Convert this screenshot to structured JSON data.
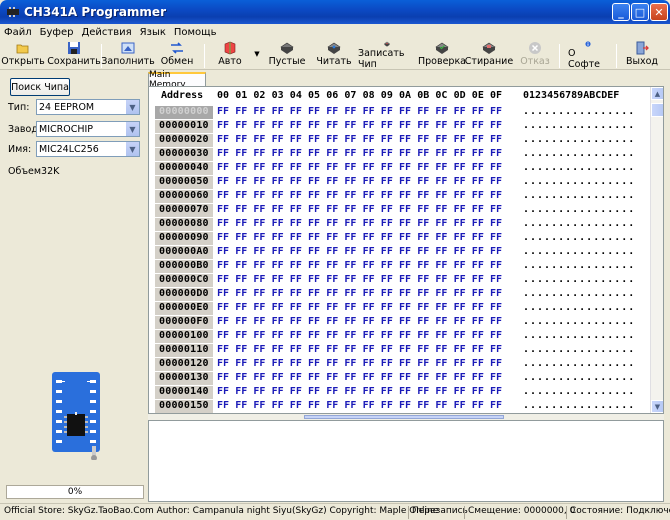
{
  "window": {
    "title": "CH341A Programmer"
  },
  "menu": [
    "Файл",
    "Буфер",
    "Действия",
    "Язык",
    "Помощь"
  ],
  "toolbar": {
    "open": "Открыть",
    "save": "Сохранить",
    "fill": "Заполнить",
    "swap": "Обмен",
    "auto": "Авто",
    "blank": "Пустые",
    "read": "Читать",
    "write": "Записать Чип",
    "verify": "Проверка",
    "erase": "Стирание",
    "cancel": "Отказ",
    "about": "О Софте",
    "exit": "Выход"
  },
  "left": {
    "search_button": "Поиск Чипа",
    "type_label": "Тип:",
    "type_value": "24 EEPROM",
    "maker_label": "Завод:",
    "maker_value": "MICROCHIP",
    "name_label": "Имя:",
    "name_value": "MIC24LC256",
    "size_label": "Объем32K",
    "progress_text": "0%",
    "progress_value": 0
  },
  "memory_tab": "Main Memory",
  "hex": {
    "address_header": "Address",
    "columns": [
      "00",
      "01",
      "02",
      "03",
      "04",
      "05",
      "06",
      "07",
      "08",
      "09",
      "0A",
      "0B",
      "0C",
      "0D",
      "0E",
      "0F"
    ],
    "ascii_header": "0123456789ABCDEF",
    "rows": [
      "00000000",
      "00000010",
      "00000020",
      "00000030",
      "00000040",
      "00000050",
      "00000060",
      "00000070",
      "00000080",
      "00000090",
      "000000A0",
      "000000B0",
      "000000C0",
      "000000D0",
      "000000E0",
      "000000F0",
      "00000100",
      "00000110",
      "00000120",
      "00000130",
      "00000140",
      "00000150"
    ],
    "byte_value": "FF",
    "ascii_value": "................",
    "selected_row": 0
  },
  "status": {
    "store": "Official Store: SkyGz.TaoBao.Com Author: Campanula night Siyu(SkyGz) Copyright: Maple Online",
    "mode": "Перезапись",
    "offset": "Смещение: 0000000, 0",
    "state": "Состояние: Подключен"
  }
}
